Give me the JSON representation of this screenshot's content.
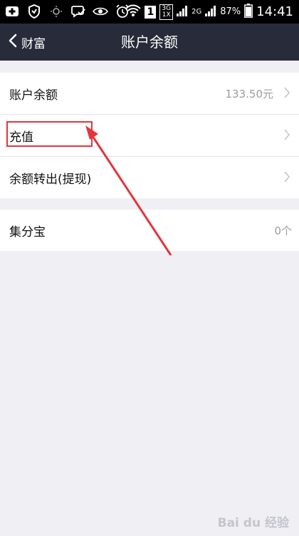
{
  "status_bar": {
    "network_top": "3G",
    "network_bottom": "1X",
    "network_2g": "2G",
    "notification_badge": "1",
    "battery": "87%",
    "time": "14:41"
  },
  "header": {
    "back_label": "财富",
    "title": "账户余额"
  },
  "group1": {
    "items": [
      {
        "label": "账户余额",
        "value": "133.50元"
      },
      {
        "label": "充值",
        "value": ""
      },
      {
        "label": "余额转出(提现)",
        "value": ""
      }
    ]
  },
  "group2": {
    "items": [
      {
        "label": "集分宝",
        "value": "0个"
      }
    ]
  },
  "watermark": "Bai du 经验",
  "colors": {
    "header_bg": "#272b3a",
    "page_bg": "#efeff4",
    "annotation": "#e2363f"
  }
}
